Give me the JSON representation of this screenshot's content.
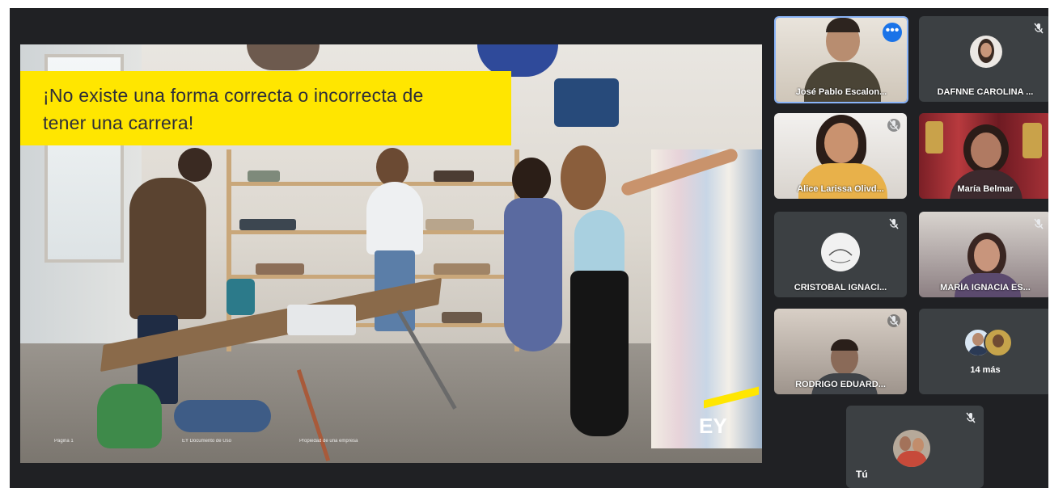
{
  "slide": {
    "banner_line1": "¡No existe una forma correcta o incorrecta de",
    "banner_line2": "tener una carrera!",
    "logo_text": "EY",
    "footer_items": [
      "Página 1",
      "EY Documento de Uso",
      "Propiedad de una empresa"
    ]
  },
  "participants": [
    {
      "name": "José Pablo Escalon...",
      "status": "active-speaker",
      "icon": "more-options-icon"
    },
    {
      "name": "DAFNNE CAROLINA ...",
      "status": "muted",
      "icon": "mic-off-icon"
    },
    {
      "name": "Alice Larissa Olivd...",
      "status": "muted",
      "icon": "mic-off-icon"
    },
    {
      "name": "María Belmar",
      "status": "video"
    },
    {
      "name": "CRISTOBAL IGNACI...",
      "status": "muted",
      "icon": "mic-off-icon"
    },
    {
      "name": "MARÍA IGNACIA ES...",
      "status": "muted",
      "icon": "mic-off-icon"
    },
    {
      "name": "RODRIGO EDUARD...",
      "status": "muted",
      "icon": "mic-off-icon"
    },
    {
      "name": "14 más",
      "status": "overflow"
    },
    {
      "name": "Tú",
      "status": "muted",
      "icon": "mic-off-icon"
    }
  ],
  "colors": {
    "meet_bg": "#202124",
    "tile_bg": "#3c4043",
    "active_border": "#8ab4f8",
    "banner_yellow": "#ffe600",
    "banner_text": "#2e2e38",
    "more_button": "#1a73e8"
  }
}
